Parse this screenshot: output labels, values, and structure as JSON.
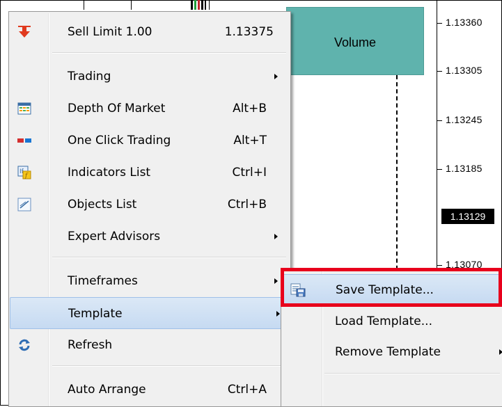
{
  "chart": {
    "price_labels": [
      "1.13360",
      "1.13305",
      "1.13245",
      "1.13185",
      "1.13070"
    ],
    "current_price": "1.13129",
    "volume_label": "Volume"
  },
  "context_menu": {
    "items": [
      {
        "label": "Sell Limit 1.00",
        "shortcut": "1.13375",
        "icon": "sell-arrow-icon"
      },
      {
        "label": "Trading",
        "submenu": true
      },
      {
        "label": "Depth Of Market",
        "shortcut": "Alt+B",
        "icon": "depth-of-market-icon"
      },
      {
        "label": "One Click Trading",
        "shortcut": "Alt+T",
        "icon": "one-click-trading-icon"
      },
      {
        "label": "Indicators List",
        "shortcut": "Ctrl+I",
        "icon": "indicators-list-icon"
      },
      {
        "label": "Objects List",
        "shortcut": "Ctrl+B",
        "icon": "objects-list-icon"
      },
      {
        "label": "Expert Advisors",
        "submenu": true
      },
      {
        "label": "Timeframes",
        "submenu": true
      },
      {
        "label": "Template",
        "submenu": true,
        "highlighted": true
      },
      {
        "label": "Refresh",
        "icon": "refresh-icon"
      },
      {
        "label": "Auto Arrange",
        "shortcut": "Ctrl+A"
      }
    ]
  },
  "template_submenu": {
    "items": [
      {
        "label": "Save Template...",
        "icon": "save-template-icon",
        "highlighted": true
      },
      {
        "label": "Load Template..."
      },
      {
        "label": "Remove Template",
        "submenu": true
      }
    ]
  },
  "colors": {
    "volume_box": "#5fb3ad",
    "highlight_outline": "#e8001c",
    "menu_background": "#f0f0f0",
    "sell_arrow": "#e03a1e"
  }
}
